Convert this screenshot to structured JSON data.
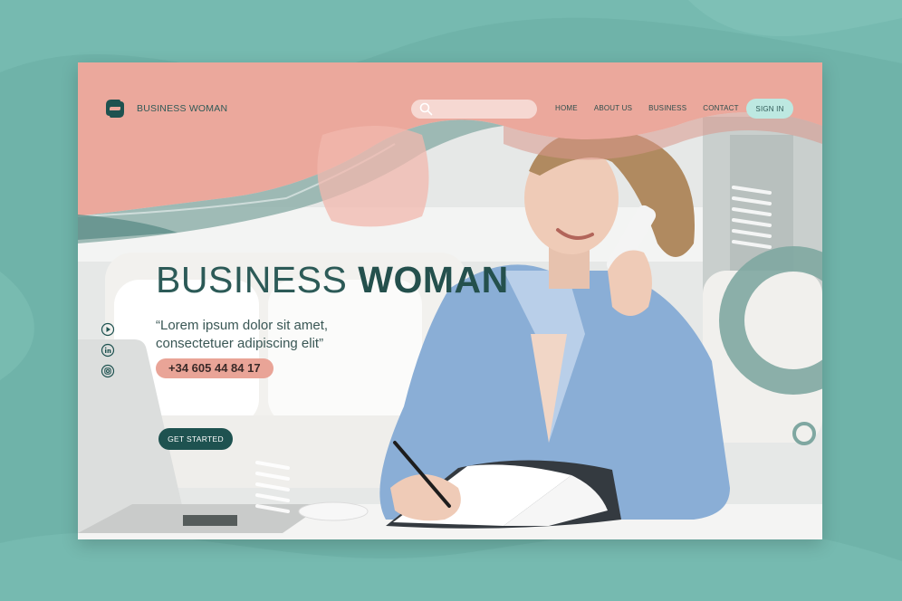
{
  "brand": {
    "name": "BUSINESS WOMAN"
  },
  "search": {
    "placeholder": ""
  },
  "nav": {
    "items": [
      {
        "label": "HOME"
      },
      {
        "label": "ABOUT US"
      },
      {
        "label": "BUSINESS"
      },
      {
        "label": "CONTACT"
      }
    ],
    "signin_label": "SIGN IN"
  },
  "hero": {
    "title_light": "BUSINESS",
    "title_bold": "WOMAN",
    "quote_line1": "“Lorem ipsum dolor sit amet,",
    "quote_line2": "consectetuer adipiscing elit”",
    "phone": "+34 605 44 84 17",
    "cta_label": "GET STARTED"
  },
  "social": [
    "play-icon",
    "linkedin-icon",
    "instagram-icon"
  ],
  "colors": {
    "background": "#6fb3a9",
    "pink": "#eba89c",
    "teal_dark": "#1e5250",
    "teal_light": "#bde8e1"
  }
}
